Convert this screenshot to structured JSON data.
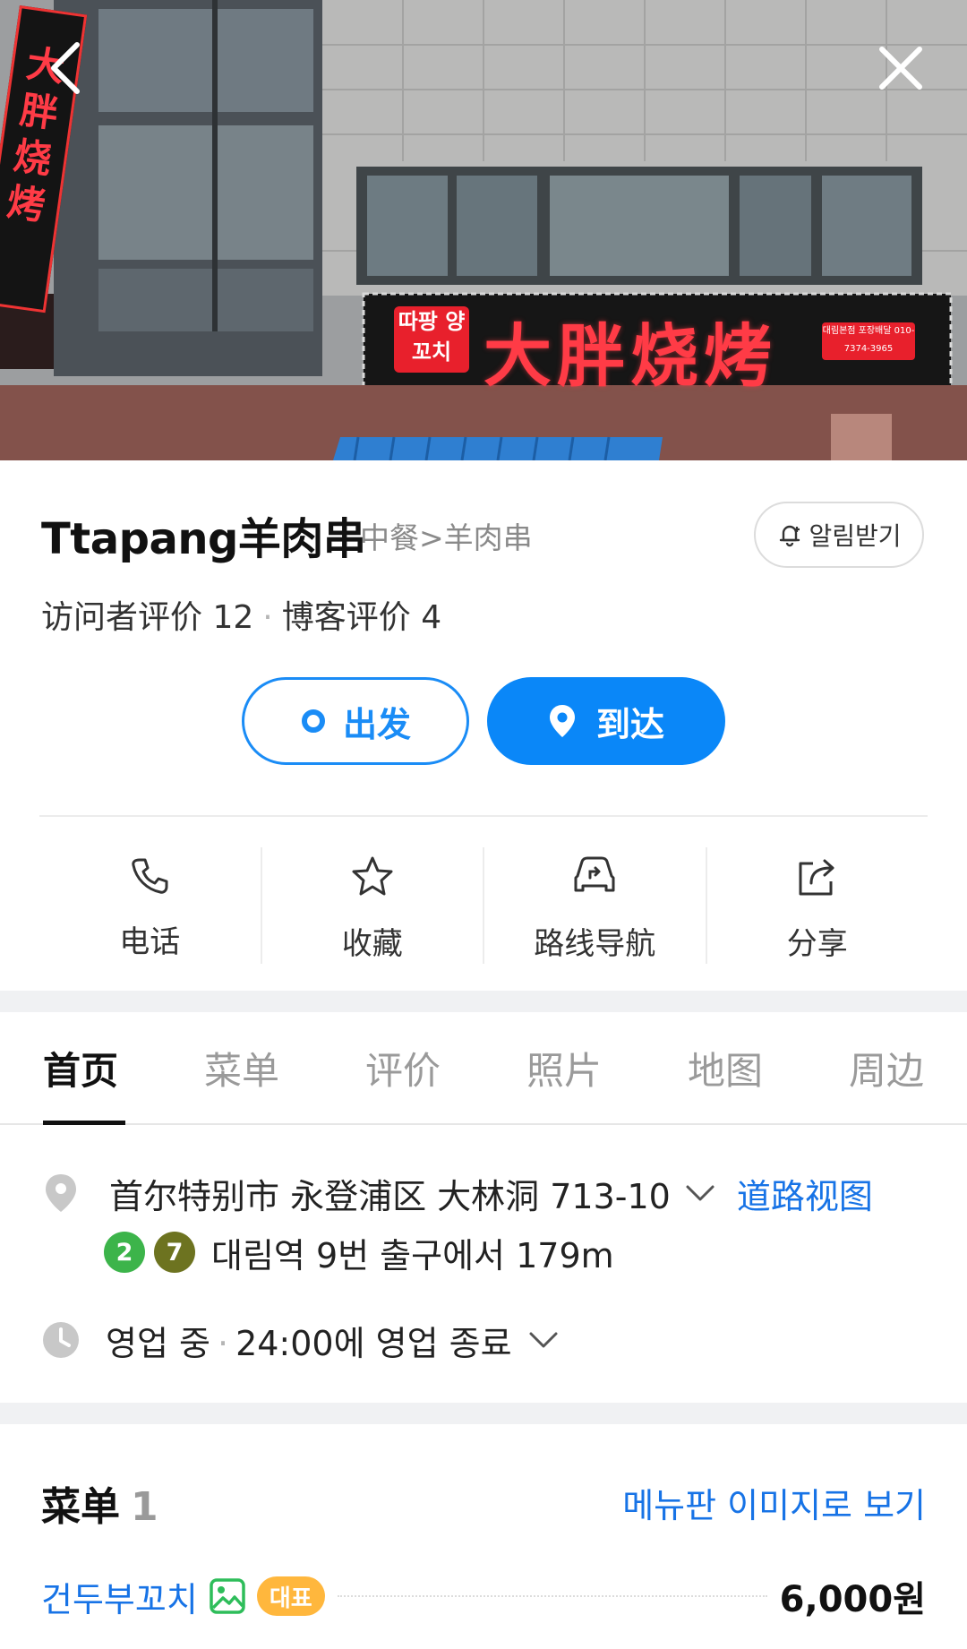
{
  "hero": {
    "back_icon": "chevron-left-icon",
    "close_icon": "close-icon",
    "signboard_text": "大胖烧烤",
    "sign_left_text": "따팡 양꼬치",
    "sign_right_text": "대림본점 포장배달 010-7374-3965",
    "vertical_sign_text": "大胖烧烤"
  },
  "place": {
    "name": "Ttapang羊肉串",
    "category": "中餐>羊肉串",
    "notify_label": "알림받기",
    "visitor_reviews_label": "访问者评价",
    "visitor_reviews_count": "12",
    "blog_reviews_label": "博客评价",
    "blog_reviews_count": "4"
  },
  "route": {
    "depart_label": "出发",
    "arrive_label": "到达"
  },
  "actions": [
    {
      "label": "电话",
      "icon": "phone-icon"
    },
    {
      "label": "收藏",
      "icon": "star-icon"
    },
    {
      "label": "路线导航",
      "icon": "car-navigation-icon"
    },
    {
      "label": "分享",
      "icon": "share-icon"
    }
  ],
  "tabs": [
    {
      "label": "首页",
      "active": true
    },
    {
      "label": "菜单",
      "active": false
    },
    {
      "label": "评价",
      "active": false
    },
    {
      "label": "照片",
      "active": false
    },
    {
      "label": "地图",
      "active": false
    },
    {
      "label": "周边",
      "active": false
    }
  ],
  "details": {
    "address": "首尔特别市 永登浦区 大林洞 713-10",
    "road_view_label": "道路视图",
    "subway_lines": [
      {
        "number": "2",
        "color": "#3cb44a"
      },
      {
        "number": "7",
        "color": "#6d7320"
      }
    ],
    "subway_text": "대림역 9번 출구에서 179m",
    "hours_status": "영업 중",
    "hours_detail": "24:00에 영업 종료"
  },
  "menu": {
    "title": "菜单",
    "count": "1",
    "view_image_label": "메뉴판 이미지로 보기",
    "items": [
      {
        "name": "건두부꼬치",
        "badge": "대표",
        "price": "6,000원"
      }
    ]
  },
  "colors": {
    "primary_blue": "#0a87f8",
    "link_blue": "#1773e6",
    "badge_orange": "#ffb73d",
    "section_gap": "#f0f1f3"
  }
}
